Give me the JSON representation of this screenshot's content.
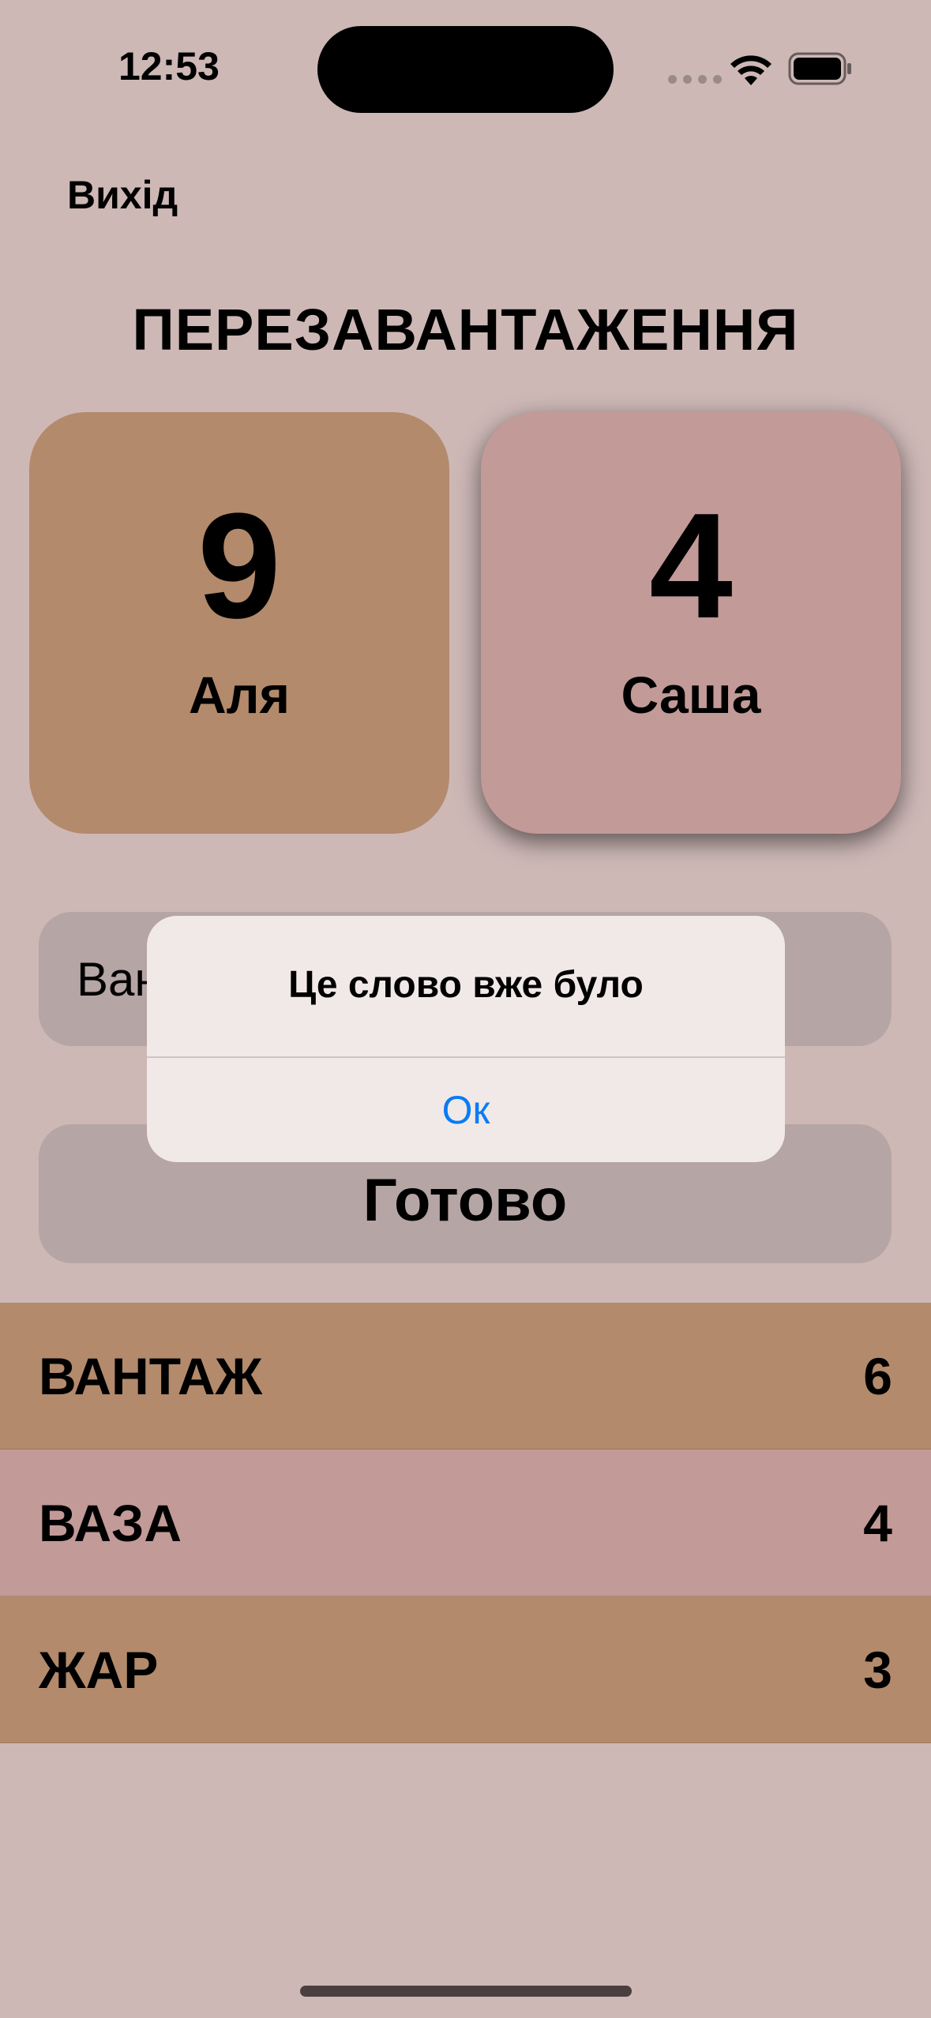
{
  "status_bar": {
    "time": "12:53",
    "icons": [
      "signal-dots-icon",
      "wifi-icon",
      "battery-icon"
    ]
  },
  "header": {
    "exit_label": "Вихід",
    "title": "ПЕРЕЗАВАНТАЖЕННЯ"
  },
  "players": [
    {
      "name": "Аля",
      "score": "9",
      "color": "#b38a6b"
    },
    {
      "name": "Саша",
      "score": "4",
      "color": "#c29a97",
      "active": true
    }
  ],
  "word_input": {
    "value": "Ван"
  },
  "done_label": "Готово",
  "words": [
    {
      "word": "ВАНТАЖ",
      "points": "6"
    },
    {
      "word": "ВАЗА",
      "points": "4"
    },
    {
      "word": "ЖАР",
      "points": "3"
    }
  ],
  "alert": {
    "title": "Це слово вже було",
    "ok_label": "Ок"
  },
  "colors": {
    "background": "#cdb8b6",
    "player_one": "#b38a6b",
    "player_two": "#c29a97",
    "alert_button": "#0a7cf5"
  }
}
